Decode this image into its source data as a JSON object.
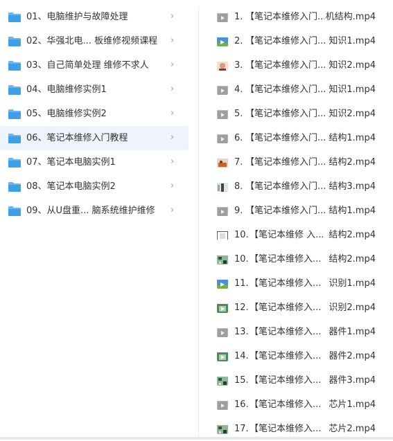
{
  "folders": [
    {
      "label": "01、电脑维护与故障处理",
      "selected": false
    },
    {
      "label": "02、华强北电... 板维修视频课程",
      "selected": false
    },
    {
      "label": "03、自己简单处理 维修不求人",
      "selected": false
    },
    {
      "label": "04、电脑维修实例1",
      "selected": false
    },
    {
      "label": "05、电脑维修实例2",
      "selected": false
    },
    {
      "label": "06、笔记本维修入门教程",
      "selected": true
    },
    {
      "label": "07、笔记本电脑实例1",
      "selected": false
    },
    {
      "label": "08、笔记本电脑实例2",
      "selected": false
    },
    {
      "label": "09、从U盘重... 脑系统维护维修",
      "selected": false
    }
  ],
  "chevron_glyph": "›",
  "files": [
    {
      "num": "1.",
      "name": "【笔记本维修入门...",
      "tail": "机结构.mp4",
      "thumb": "gray"
    },
    {
      "num": "2.",
      "name": "【笔记本维修入门...",
      "tail": "知识1.mp4",
      "thumb": "landscape"
    },
    {
      "num": "3.",
      "name": "【笔记本维修入门...",
      "tail": "知识2.mp4",
      "thumb": "face"
    },
    {
      "num": "4.",
      "name": "【笔记本维修入门...",
      "tail": "知识1.mp4",
      "thumb": "gray"
    },
    {
      "num": "5.",
      "name": "【笔记本维修入门...",
      "tail": "知识2.mp4",
      "thumb": "gray"
    },
    {
      "num": "6.",
      "name": "【笔记本维修入门...",
      "tail": "结构1.mp4",
      "thumb": "gray"
    },
    {
      "num": "7.",
      "name": "【笔记本维修入门...",
      "tail": "结构2.mp4",
      "thumb": "photo"
    },
    {
      "num": "8.",
      "name": "【笔记本维修入门...",
      "tail": "结构3.mp4",
      "thumb": "figure"
    },
    {
      "num": "9.",
      "name": "【笔记本维修入门...",
      "tail": "结构1.mp4",
      "thumb": "gray"
    },
    {
      "num": "10.",
      "name": "【笔记本维修 入...",
      "tail": "结构2.mp4",
      "thumb": "mono"
    },
    {
      "num": "10.",
      "name": "【笔记本维修入...",
      "tail": "结构2.mp4",
      "thumb": "board"
    },
    {
      "num": "11.",
      "name": "【笔记本维修入...",
      "tail": "识别1.mp4",
      "thumb": "landscape"
    },
    {
      "num": "12.",
      "name": "【笔记本维修入...",
      "tail": "识别2.mp4",
      "thumb": "green"
    },
    {
      "num": "13.",
      "name": "【笔记本维修入...",
      "tail": "器件1.mp4",
      "thumb": "gray"
    },
    {
      "num": "14.",
      "name": "【笔记本维修入...",
      "tail": "器件2.mp4",
      "thumb": "green"
    },
    {
      "num": "15.",
      "name": "【笔记本维修入...",
      "tail": "器件3.mp4",
      "thumb": "board"
    },
    {
      "num": "16.",
      "name": "【笔记本维修入...",
      "tail": "芯片1.mp4",
      "thumb": "gray"
    },
    {
      "num": "17.",
      "name": "【笔记本维修入...",
      "tail": "芯片2.mp4",
      "thumb": "board"
    }
  ],
  "colors": {
    "folder": "#3d9fe8",
    "folder_tab": "#6cb6ee",
    "selected_bg": "#eef3fc",
    "text": "#333333",
    "chevron": "#9a9a9a"
  }
}
